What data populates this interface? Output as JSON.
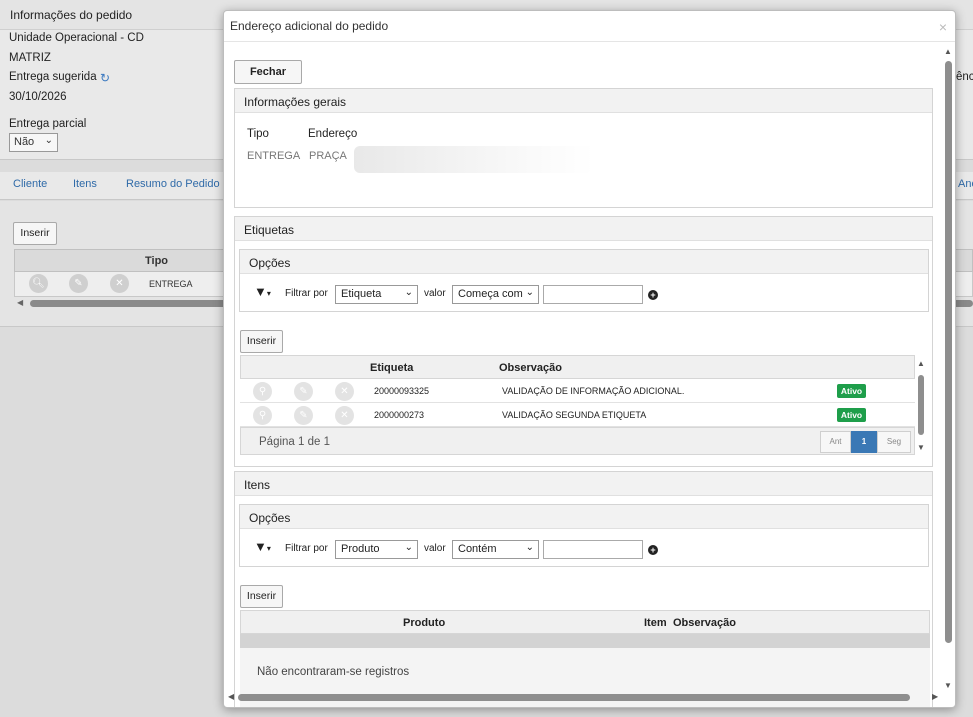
{
  "background": {
    "panel_title": "Informações do pedido",
    "unit_label": "Unidade Operacional - CD",
    "unit_value": "MATRIZ",
    "delivery_label": "Entrega sugerida",
    "delivery_date": "30/10/2026",
    "partial_label": "Entrega parcial",
    "partial_value": "Não",
    "right_cut_text": "ênci",
    "tabs": [
      "Cliente",
      "Itens",
      "Resumo do Pedido"
    ],
    "right_tab_cut": "Anc",
    "insert_label": "Inserir",
    "grid": {
      "header_tipo": "Tipo",
      "row_tipo": "ENTREGA"
    }
  },
  "modal": {
    "title": "Endereço adicional do pedido",
    "close_symbol": "×",
    "close_button": "Fechar",
    "general": {
      "title": "Informações gerais",
      "type_label": "Tipo",
      "address_label": "Endereço",
      "type_value": "ENTREGA",
      "address_value": "PRAÇA"
    },
    "tags": {
      "title": "Etiquetas",
      "options_title": "Opções",
      "filter_by": "Filtrar por",
      "filter_field": "Etiqueta",
      "value_label": "valor",
      "operator": "Começa com",
      "insert_label": "Inserir",
      "columns": [
        "Etiqueta",
        "Observação"
      ],
      "rows": [
        {
          "tag": "20000093325",
          "note": "VALIDAÇÃO DE INFORMAÇÃO ADICIONAL.",
          "status": "Ativo"
        },
        {
          "tag": "2000000273",
          "note": "VALIDAÇÃO SEGUNDA ETIQUETA",
          "status": "Ativo"
        }
      ],
      "pager_text": "Página 1 de 1",
      "pager_prev": "Ant",
      "pager_current": "1",
      "pager_next": "Seg"
    },
    "items": {
      "title": "Itens",
      "options_title": "Opções",
      "filter_by": "Filtrar por",
      "filter_field": "Produto",
      "value_label": "valor",
      "operator": "Contém",
      "insert_label": "Inserir",
      "columns": [
        "Produto",
        "Item",
        "Observação"
      ],
      "empty_text": "Não encontraram-se registros"
    }
  },
  "colors": {
    "active_badge": "#1e9e4a",
    "link": "#2f6aa8",
    "pager_active": "#3a78b5"
  }
}
